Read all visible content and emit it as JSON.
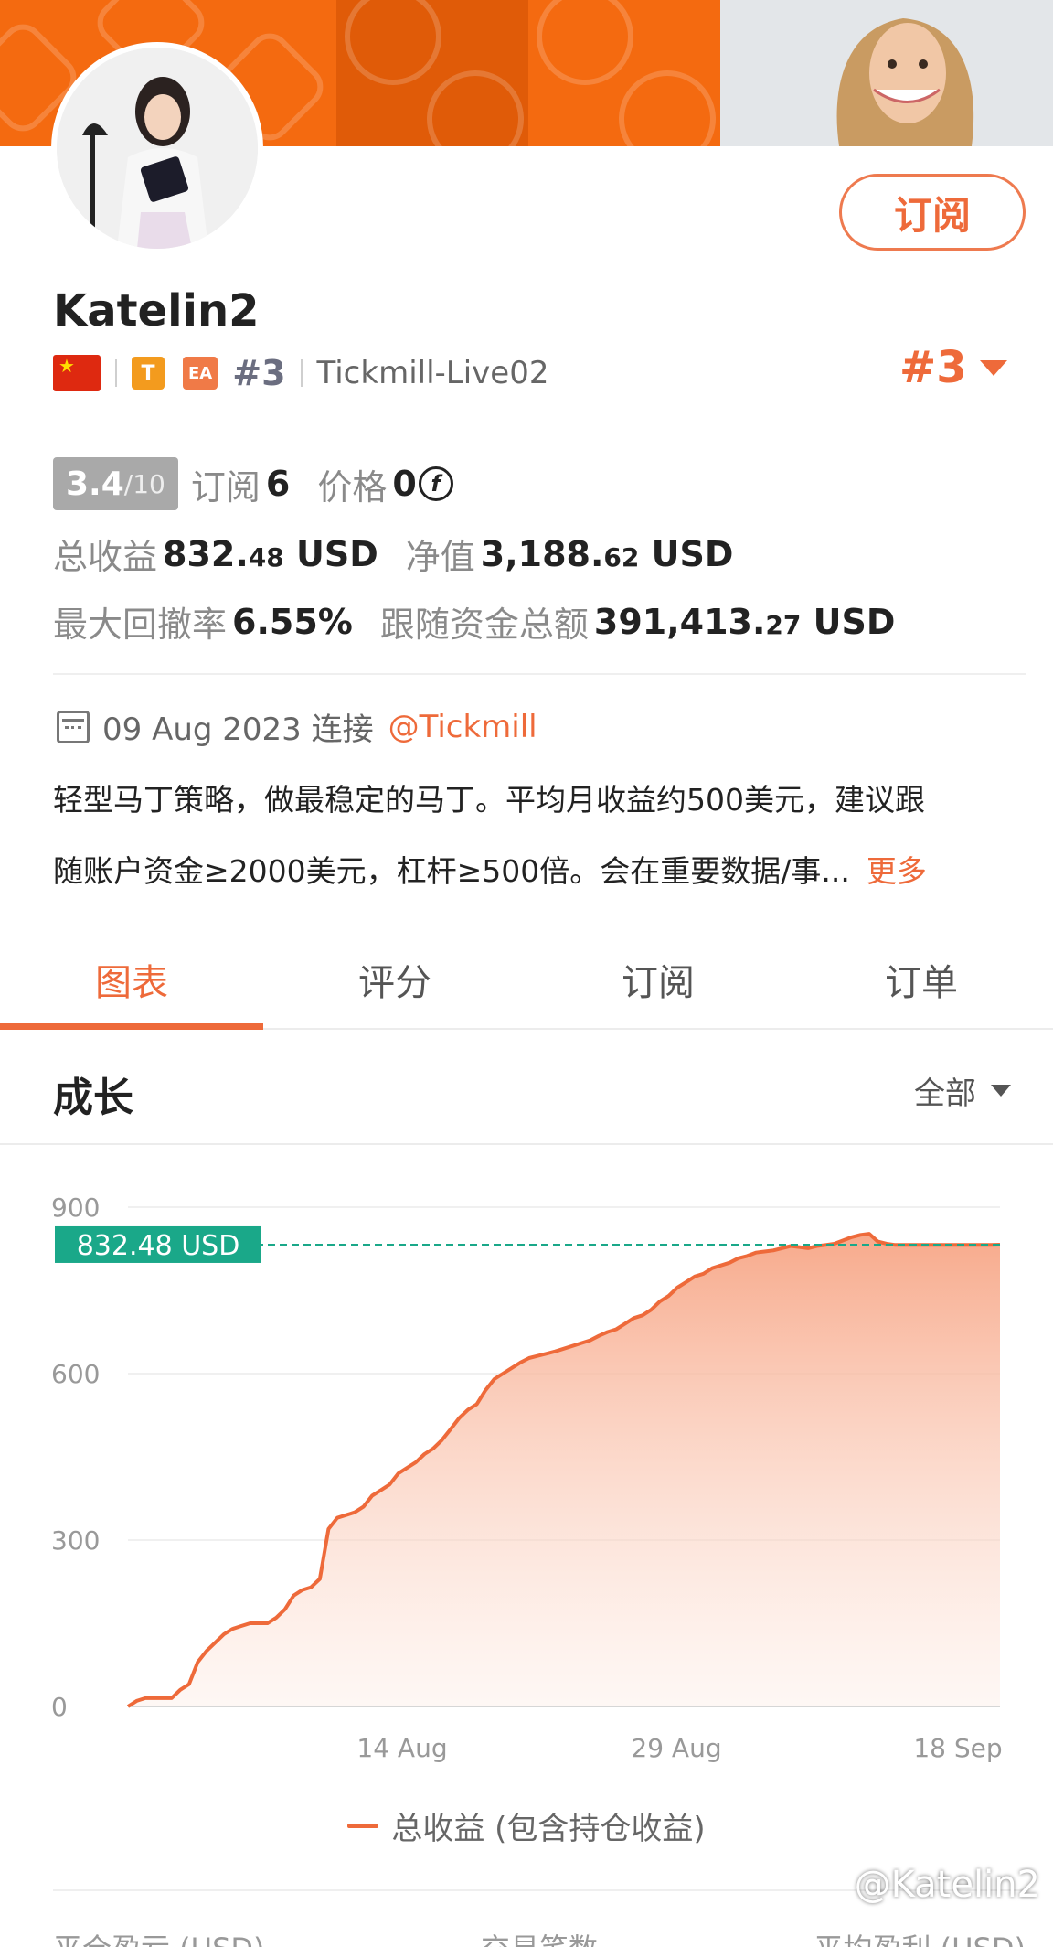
{
  "header": {
    "subscribe_label": "订阅"
  },
  "profile": {
    "username": "Katelin2",
    "tag_t": "T",
    "tag_ea": "EA",
    "rank_small": "#3",
    "broker_server": "Tickmill-Live02",
    "rank_right": "#3"
  },
  "stats": {
    "score": "3.4",
    "score_max": "/10",
    "subs_label": "订阅",
    "subs_value": "6",
    "price_label": "价格",
    "price_value": "0",
    "total_profit_label": "总收益",
    "total_profit_int": "832.",
    "total_profit_dec": "48",
    "total_profit_unit": " USD",
    "equity_label": "净值",
    "equity_int": "3,188.",
    "equity_dec": "62",
    "equity_unit": " USD",
    "drawdown_label": "最大回撤率",
    "drawdown_value": "6.55%",
    "follow_funds_label": "跟随资金总额",
    "follow_funds_int": "391,413.",
    "follow_funds_dec": "27",
    "follow_funds_unit": " USD"
  },
  "meta": {
    "date": "09 Aug 2023 连接",
    "broker_link": "@Tickmill"
  },
  "description": {
    "line1": "轻型马丁策略，做最稳定的马丁。平均月收益约500美元，建议跟",
    "line2": "随账户资金≥2000美元，杠杆≥500倍。会在重要数据/事...",
    "more": "更多"
  },
  "tabs": [
    "图表",
    "评分",
    "订阅",
    "订单"
  ],
  "section": {
    "title": "成长",
    "filter": "全部"
  },
  "legend": {
    "label": "总收益 (包含持仓收益)"
  },
  "bottom_labels": [
    "平仓盈亏 (USD)",
    "交易笔数",
    "平均盈利 (USD)"
  ],
  "watermark": "@Katelin2",
  "colors": {
    "accent": "#ee6a3a",
    "banner": "#f46a10",
    "badge_green": "#1aa889"
  },
  "chart_data": {
    "type": "area",
    "x_tick_labels": [
      "14 Aug",
      "29 Aug",
      "18 Sep"
    ],
    "y_ticks": [
      0,
      300,
      600,
      900
    ],
    "ylim": [
      0,
      900
    ],
    "current_value_label": "832.48 USD",
    "current_value": 832.48,
    "series": [
      {
        "x": [
          0,
          1,
          2,
          3,
          4,
          5,
          6,
          7,
          8,
          9,
          10,
          11,
          12,
          13,
          14,
          15,
          16,
          17,
          18,
          19,
          20,
          21,
          22,
          23,
          24,
          25,
          26,
          27,
          28,
          29,
          30,
          31,
          32,
          33,
          34,
          35,
          36,
          37,
          38,
          39,
          40,
          41,
          42,
          43,
          44,
          45,
          46,
          47,
          48,
          49,
          50,
          51,
          52,
          53,
          54,
          55,
          56,
          57,
          58,
          59,
          60,
          61,
          62,
          63,
          64,
          65,
          66,
          67,
          68,
          69,
          70,
          71,
          72,
          73,
          74,
          75,
          76,
          77,
          78,
          79,
          80,
          81,
          82,
          83,
          84,
          85,
          86,
          87,
          88,
          89,
          90,
          91,
          92,
          93,
          94,
          95,
          96,
          97,
          98,
          99,
          100
        ],
        "values": [
          0,
          10,
          15,
          15,
          15,
          15,
          30,
          40,
          80,
          100,
          115,
          130,
          140,
          145,
          150,
          150,
          150,
          160,
          175,
          200,
          210,
          215,
          230,
          320,
          340,
          345,
          350,
          360,
          380,
          390,
          400,
          420,
          430,
          440,
          455,
          465,
          480,
          500,
          520,
          535,
          545,
          570,
          590,
          600,
          610,
          620,
          628,
          632,
          636,
          640,
          645,
          650,
          655,
          660,
          668,
          675,
          680,
          690,
          700,
          705,
          715,
          730,
          740,
          755,
          765,
          775,
          780,
          790,
          795,
          800,
          808,
          812,
          818,
          820,
          822,
          826,
          830,
          828,
          826,
          830,
          832,
          834,
          840,
          846,
          850,
          852,
          838,
          834,
          832,
          832,
          832,
          832,
          832,
          832,
          832,
          832,
          832,
          832,
          832,
          832,
          832.48
        ]
      }
    ]
  }
}
